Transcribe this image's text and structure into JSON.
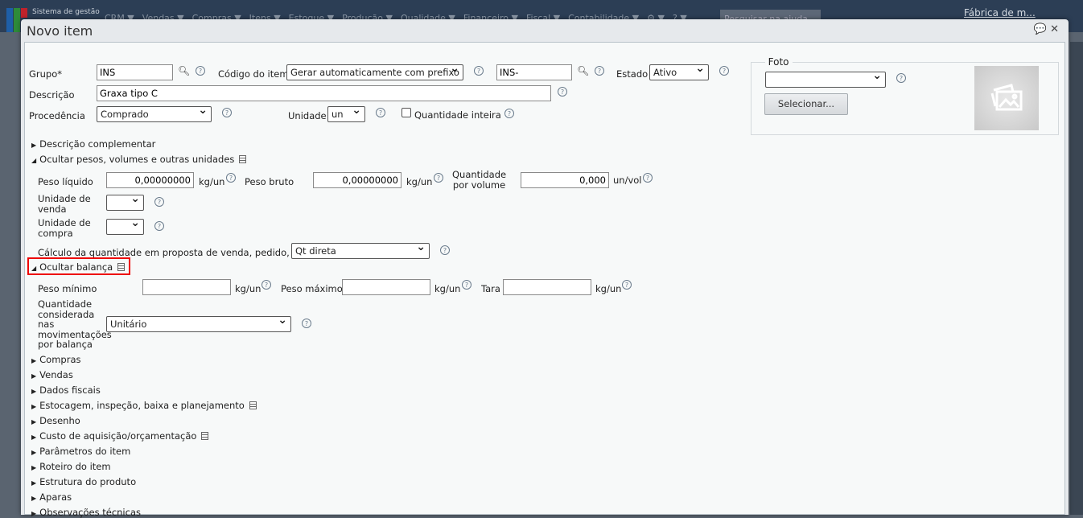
{
  "topbar": {
    "app_name": "Sistema de gestão",
    "nav": [
      "CRM ▼",
      "Vendas ▼",
      "Compras ▼",
      "Itens ▼",
      "Estoque ▼",
      "Produção ▼",
      "Qualidade ▼",
      "Financeiro ▼",
      "Fiscal ▼",
      "Contabilidade ▼",
      "⚙ ▼",
      "? ▼"
    ],
    "help_search_placeholder": "Pesquisar na ajuda",
    "company": "Fábrica de m..."
  },
  "dialog": {
    "title": "Novo item",
    "chat_icon": "💬",
    "close_icon": "✕"
  },
  "form": {
    "grupo_label": "Grupo*",
    "grupo_value": "INS",
    "codigo_label": "Código do item",
    "codigo_mode": "Gerar automaticamente com prefixo",
    "codigo_prefix": "INS-",
    "estado_label": "Estado",
    "estado_value": "Ativo",
    "descricao_label": "Descrição",
    "descricao_value": "Graxa tipo C",
    "procedencia_label": "Procedência",
    "procedencia_value": "Comprado",
    "unidade_label": "Unidade",
    "unidade_value": "un",
    "qtd_inteira_label": "Quantidade inteira"
  },
  "foto": {
    "legend": "Foto",
    "select_value": "",
    "button": "Selecionar..."
  },
  "sections": {
    "descricao_complementar": "Descrição complementar",
    "pesos": "Ocultar pesos, volumes e outras unidades",
    "balanca": "Ocultar balança",
    "collapsed": [
      "Compras",
      "Vendas",
      "Dados fiscais",
      "Estocagem, inspeção, baixa e planejamento",
      "Desenho",
      "Custo de aquisição/orçamentação",
      "Parâmetros do item",
      "Roteiro do item",
      "Estrutura do produto",
      "Aparas",
      "Observações técnicas"
    ]
  },
  "pesos": {
    "peso_liquido_label": "Peso líquido",
    "peso_liquido_value": "0,00000000",
    "peso_liquido_unit": "kg/un",
    "peso_bruto_label": "Peso bruto",
    "peso_bruto_value": "0,00000000",
    "peso_bruto_unit": "kg/un",
    "qtd_volume_label1": "Quantidade",
    "qtd_volume_label2": "por volume",
    "qtd_volume_value": "0,000",
    "qtd_volume_unit": "un/vol",
    "un_venda_label1": "Unidade de",
    "un_venda_label2": "venda",
    "un_compra_label1": "Unidade de",
    "un_compra_label2": "compra",
    "calculo_label": "Cálculo da quantidade em proposta de venda, pedido, NF",
    "calculo_value": "Qt direta"
  },
  "balanca": {
    "peso_min_label": "Peso mínimo",
    "peso_min_unit": "kg/un",
    "peso_max_label": "Peso máximo",
    "peso_max_unit": "kg/un",
    "tara_label": "Tara",
    "tara_unit": "kg/un",
    "qtd_label": [
      "Quantidade",
      "considerada",
      "nas",
      "movimentações",
      "por balança"
    ],
    "qtd_value": "Unitário"
  }
}
